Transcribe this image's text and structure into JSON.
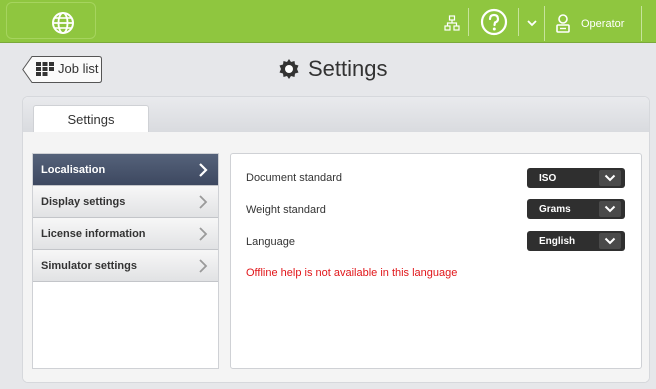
{
  "colors": {
    "topbar": "#8fc63f",
    "sidebar_active": "#414c63",
    "warning": "#e1161a"
  },
  "topbar": {
    "globe_icon": "globe-icon",
    "network_icon": "network-icon",
    "help_icon": "help-icon",
    "user_icon": "user-icon",
    "operator_label": "Operator"
  },
  "header": {
    "back_label": "Job list",
    "back_icon": "grid-icon",
    "title": "Settings",
    "title_icon": "gear-icon"
  },
  "tabs": [
    {
      "label": "Settings",
      "active": true
    }
  ],
  "sidebar": {
    "items": [
      {
        "label": "Localisation",
        "active": true
      },
      {
        "label": "Display settings",
        "active": false
      },
      {
        "label": "License information",
        "active": false
      },
      {
        "label": "Simulator settings",
        "active": false
      }
    ]
  },
  "settings": {
    "rows": [
      {
        "label": "Document standard",
        "value": "ISO"
      },
      {
        "label": "Weight standard",
        "value": "Grams"
      },
      {
        "label": "Language",
        "value": "English"
      }
    ],
    "warning": "Offline help is not available in this language"
  }
}
